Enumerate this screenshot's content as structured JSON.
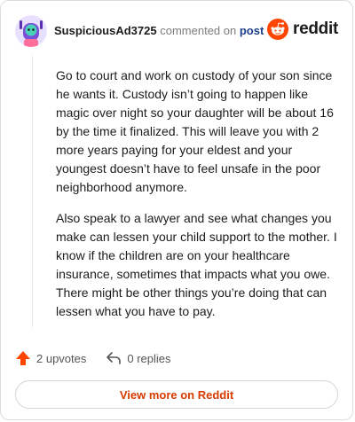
{
  "header": {
    "username": "SuspiciousAd3725",
    "verb": "commented on",
    "post_link": "post",
    "brand": "reddit",
    "icons": {
      "avatar": "snoo-avatar",
      "logo": "reddit-snoo-logo"
    }
  },
  "comment": {
    "paragraphs": [
      "Go to court and work on custody of your son since he wants it. Custody isn’t going to happen like magic over night so your daughter will be about 16 by the time it finalized. This will leave you with 2 more years paying for your eldest and your youngest doesn’t have to feel unsafe in the poor neighborhood anymore.",
      "Also speak to a lawyer and see what changes you make can lessen your child support to the mother. I know if the children are on your healthcare insurance, sometimes that impacts what you owe. There might be other things you’re doing that can lessen what you have to pay."
    ]
  },
  "actions": {
    "upvotes": "2 upvotes",
    "replies": "0 replies",
    "icons": {
      "upvote": "upvote-arrow-icon",
      "reply": "reply-arrow-icon"
    }
  },
  "footer": {
    "view_more": "View more on Reddit"
  },
  "colors": {
    "accent": "#ff4500",
    "link": "#1d3f8a",
    "cta": "#d93a00"
  }
}
